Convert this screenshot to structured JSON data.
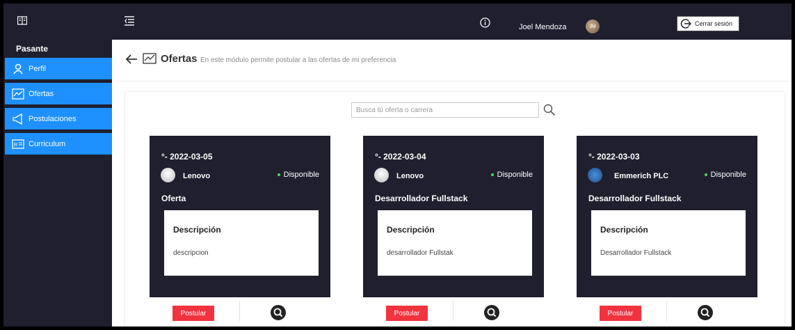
{
  "sidebar": {
    "title": "Pasante",
    "items": [
      {
        "label": "Perfil",
        "icon": "user-icon"
      },
      {
        "label": "Ofertas",
        "icon": "chart-icon"
      },
      {
        "label": "Postulaciones",
        "icon": "megaphone-icon"
      },
      {
        "label": "Curriculum",
        "icon": "id-card-icon"
      }
    ]
  },
  "topbar": {
    "user_name": "Joel Mendoza",
    "avatar_initials": "JM",
    "logout_label": "Cerrar sesión"
  },
  "page": {
    "title": "Ofertas",
    "subtitle": "En este módulo permite postular a las ofertas de mi preferencia"
  },
  "search": {
    "placeholder": "Busca tú oferta o carrera"
  },
  "offers": [
    {
      "date": "°- 2022-03-05",
      "company": "Lenovo",
      "status": "Disponible",
      "role": "Oferta",
      "desc_title": "Descripción",
      "desc": "descripcion",
      "apply_label": "Postular"
    },
    {
      "date": "°- 2022-03-04",
      "company": "Lenovo",
      "status": "Disponible",
      "role": "Desarrollador Fullstack",
      "desc_title": "Descripción",
      "desc": "desarrollador Fullstak",
      "apply_label": "Postular"
    },
    {
      "date": "°- 2022-03-03",
      "company": "Emmerich PLC",
      "status": "Disponible",
      "role": "Desarrollador Fullstack",
      "desc_title": "Descripción",
      "desc": "Desarrollador Fullstack",
      "apply_label": "Postular"
    }
  ],
  "colors": {
    "dark": "#1f1f2e",
    "accent_blue": "#1e90ff",
    "button_red": "#f0333f",
    "status_green": "#4cd964"
  }
}
